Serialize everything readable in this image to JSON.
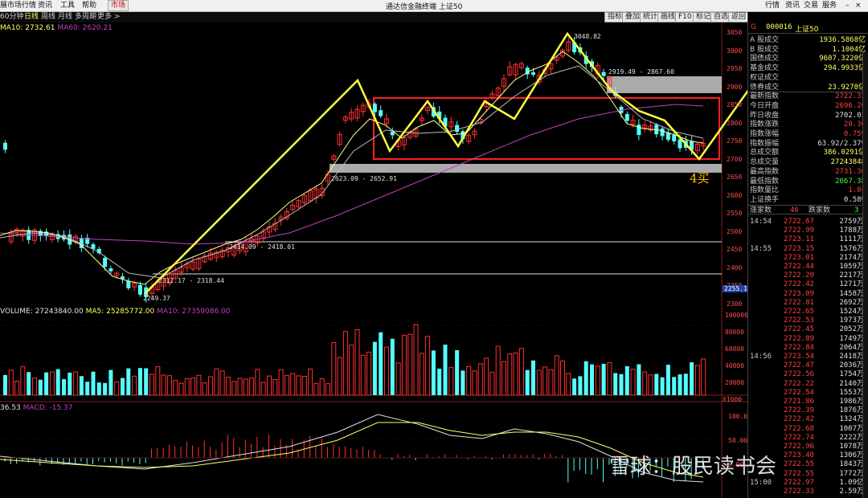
{
  "menu": {
    "items": [
      "展市场行情",
      "资讯",
      "工具",
      "帮助",
      "市场"
    ],
    "title": "通达信金融终端 上证50",
    "right_items": [
      "行情",
      "资讯",
      "交易",
      "服务"
    ]
  },
  "period_bar": {
    "items": [
      "60分钟",
      "日线",
      "周线",
      "月线",
      "多周期",
      "更多 >"
    ],
    "selected": "日线",
    "tools": [
      "指标",
      "叠加",
      "统计",
      "画线",
      "F10",
      "标记",
      "自选",
      "返回"
    ]
  },
  "indicators": {
    "ma_line": "MA10: 2732.61",
    "ma60": "MA60: 2620.21",
    "volume_line": "VOLUME: 27243840.00",
    "vol_ma5": "MA5: 25285772.00",
    "vol_ma10": "MA10: 27359086.00",
    "macd_prefix": "36.53",
    "macd": "MACD: -15.37"
  },
  "price_axis": [
    "3050",
    "3000",
    "2950",
    "2900",
    "2850",
    "2800",
    "2750",
    "2700",
    "2650",
    "2600",
    "2550",
    "2500",
    "2450",
    "2400",
    "2350",
    "2300"
  ],
  "current_price_tag": "2255.1",
  "volume_axis": [
    "100000",
    "80000",
    "60000",
    "40000",
    "20000"
  ],
  "volume_unit": "X1000",
  "macd_axis": [
    "100.0",
    "50.00",
    "0.00"
  ],
  "annotations": {
    "high": "3048.82",
    "gap_upper": "2919.49 - 2867.60",
    "gap_lower": "2623.09 - 2652.91",
    "mid_gap": "2414.09 - 2418.01",
    "low_gap": "2312.17 - 2318.44",
    "low": "2249.37",
    "pattern_label": "4买"
  },
  "quote": {
    "code": "000016",
    "name": "上证50",
    "marker": "G",
    "rows": [
      {
        "label": "A 股成交",
        "value": "1936.5868亿",
        "color": "#ffff66"
      },
      {
        "label": "B 股成交",
        "value": "1.1004亿",
        "color": "#ffff66"
      },
      {
        "label": "国债成交",
        "value": "9607.3220亿",
        "color": "#ffff66"
      },
      {
        "label": "基金成交",
        "value": "294.9933亿",
        "color": "#ffff66"
      },
      {
        "label": "权证成交",
        "value": "",
        "color": "#ffff66"
      },
      {
        "label": "债券成交",
        "value": "23.9278亿",
        "color": "#ffff66"
      },
      {
        "label": "最新指数",
        "value": "2722.33",
        "color": "#ff4040"
      },
      {
        "label": "今日开盘",
        "value": "2696.26",
        "color": "#ff4040"
      },
      {
        "label": "昨日收盘",
        "value": "2702.03",
        "color": "#e0e0e0"
      },
      {
        "label": "指数涨跌",
        "value": "20.30",
        "color": "#ff4040"
      },
      {
        "label": "指数涨幅",
        "value": "0.75%",
        "color": "#ff4040"
      },
      {
        "label": "指数振幅",
        "value": "63.92/2.37%",
        "color": "#e0e0e0"
      },
      {
        "label": "总成交额",
        "value": "386.0291亿",
        "color": "#ffff66"
      },
      {
        "label": "总成交量",
        "value": "27243848",
        "color": "#ffff66"
      },
      {
        "label": "最高指数",
        "value": "2731.30",
        "color": "#ff4040"
      },
      {
        "label": "最低指数",
        "value": "2667.38",
        "color": "#40ff40"
      },
      {
        "label": "指数量比",
        "value": "1.04",
        "color": "#ff4040"
      },
      {
        "label": "上证换手",
        "value": "0.58%",
        "color": "#e0e0e0"
      }
    ],
    "advance_label": "涨家数",
    "advance": "46",
    "decline_label": "跌家数",
    "decline": "3"
  },
  "ticks": [
    {
      "time": "14:54",
      "price": "2722.67",
      "vol": "2759万"
    },
    {
      "time": "",
      "price": "2722.99",
      "vol": "1788万"
    },
    {
      "time": "",
      "price": "2723.11",
      "vol": "1111万"
    },
    {
      "time": "14:55",
      "price": "2723.15",
      "vol": "1576万"
    },
    {
      "time": "",
      "price": "2723.01",
      "vol": "2174万"
    },
    {
      "time": "",
      "price": "2722.44",
      "vol": "1059万"
    },
    {
      "time": "",
      "price": "2722.20",
      "vol": "2217万"
    },
    {
      "time": "",
      "price": "2722.42",
      "vol": "1271万"
    },
    {
      "time": "",
      "price": "2723.09",
      "vol": "1458万"
    },
    {
      "time": "",
      "price": "2722.81",
      "vol": "2692万"
    },
    {
      "time": "",
      "price": "2722.65",
      "vol": "1524万"
    },
    {
      "time": "",
      "price": "2722.53",
      "vol": "1973万"
    },
    {
      "time": "",
      "price": "2722.45",
      "vol": "2052万"
    },
    {
      "time": "",
      "price": "2722.89",
      "vol": "1749万"
    },
    {
      "time": "",
      "price": "2722.84",
      "vol": "2064万"
    },
    {
      "time": "14:56",
      "price": "2723.54",
      "vol": "2418万"
    },
    {
      "time": "",
      "price": "2722.47",
      "vol": "2036万"
    },
    {
      "time": "",
      "price": "2722.56",
      "vol": "1754万"
    },
    {
      "time": "",
      "price": "2722.22",
      "vol": "2140万"
    },
    {
      "time": "",
      "price": "2722.54",
      "vol": "1553万"
    },
    {
      "time": "",
      "price": "2721.86",
      "vol": "1986万"
    },
    {
      "time": "",
      "price": "2722.39",
      "vol": "1876万"
    },
    {
      "time": "",
      "price": "2722.42",
      "vol": "1324万"
    },
    {
      "time": "",
      "price": "2722.68",
      "vol": "1007万"
    },
    {
      "time": "",
      "price": "2722.74",
      "vol": "2222万"
    },
    {
      "time": "",
      "price": "2722.96",
      "vol": "1078万"
    },
    {
      "time": "",
      "price": "2723.40",
      "vol": "1306万"
    },
    {
      "time": "",
      "price": "2722.55",
      "vol": "1843万"
    },
    {
      "time": "",
      "price": "2722.55",
      "vol": "1772万"
    },
    {
      "time": "15:00",
      "price": "2722.97",
      "vol": "1.09亿"
    },
    {
      "time": "",
      "price": "2722.33",
      "vol": "2.59万"
    }
  ],
  "watermark": "雪球：股民读书会",
  "colors": {
    "up": "#ff3030",
    "down": "#54ffff",
    "annotation_yellow": "#ffff3c",
    "box_red": "#ff2020",
    "ma_purple": "#c040c0"
  }
}
